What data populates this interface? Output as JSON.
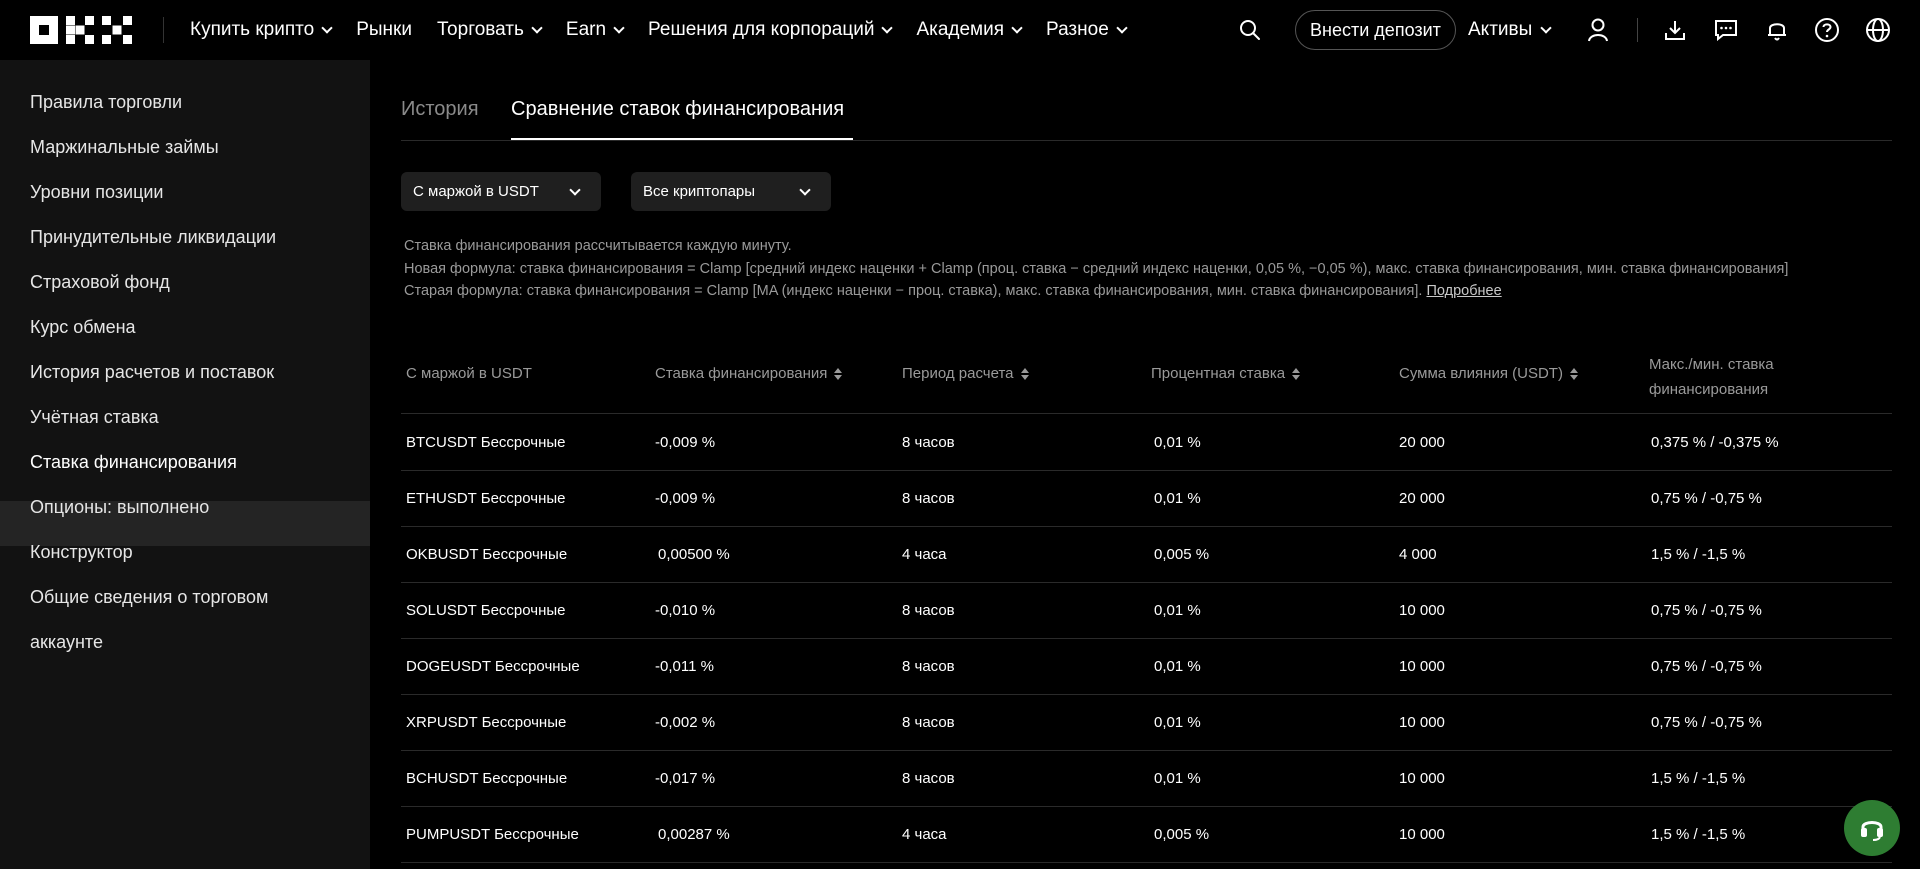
{
  "nav": {
    "items": [
      {
        "label": "Купить крипто",
        "dropdown": true
      },
      {
        "label": "Рынки",
        "dropdown": false
      },
      {
        "label": "Торговать",
        "dropdown": true
      },
      {
        "label": "Earn",
        "dropdown": true
      },
      {
        "label": "Решения для корпораций",
        "dropdown": true
      },
      {
        "label": "Академия",
        "dropdown": true
      },
      {
        "label": "Разное",
        "dropdown": true
      }
    ],
    "deposit_label": "Внести депозит",
    "assets_label": "Активы"
  },
  "sidebar": {
    "items": [
      {
        "label": "Правила торговли"
      },
      {
        "label": "Маржинальные займы"
      },
      {
        "label": "Уровни позиции"
      },
      {
        "label": "Принудительные ликвидации"
      },
      {
        "label": "Страховой фонд"
      },
      {
        "label": "Курс обмена"
      },
      {
        "label": "История расчетов и поставок"
      },
      {
        "label": "Учётная ставка"
      },
      {
        "label": "Ставка финансирования",
        "active": true
      },
      {
        "label": "Опционы: выполнено"
      },
      {
        "label": "Конструктор"
      },
      {
        "label": "Общие сведения о торговом"
      },
      {
        "label": "аккаунте"
      }
    ]
  },
  "tabs": {
    "history": "История",
    "compare": "Сравнение ставок финансирования"
  },
  "filters": {
    "margin": "С маржой в USDT",
    "pairs": "Все криптопары"
  },
  "notes": {
    "line1": "Ставка финансирования рассчитывается каждую минуту.",
    "line2": "Новая формула: ставка финансирования = Clamp [средний индекс наценки + Clamp (проц. ставка − средний индекс наценки, 0,05 %, −0,05 %), макс. ставка финансирования, мин. ставка финансирования]",
    "line3": "Старая формула: ставка финансирования = Clamp [MA (индекс наценки − проц. ставка), макс. ставка финансирования, мин. ставка финансирования].",
    "more_link": "Подробнее"
  },
  "table": {
    "headers": {
      "pair": "С маржой в USDT",
      "rate": "Ставка финансирования",
      "period": "Период расчета",
      "interest": "Процентная ставка",
      "impact": "Сумма влияния (USDT)",
      "maxmin_line1": "Макс./мин. ставка",
      "maxmin_line2": "финансирования"
    },
    "rows": [
      {
        "pair": "BTCUSDT Бессрочные",
        "rate": "-0,009 %",
        "period": "8 часов",
        "interest": "0,01 %",
        "impact": "20 000",
        "maxmin": "0,375 % / -0,375 %"
      },
      {
        "pair": "ETHUSDT Бессрочные",
        "rate": "-0,009 %",
        "period": "8 часов",
        "interest": "0,01 %",
        "impact": "20 000",
        "maxmin": "0,75 % / -0,75 %"
      },
      {
        "pair": "OKBUSDT Бессрочные",
        "rate": " 0,00500 %",
        "period": "4 часа",
        "interest": "0,005 %",
        "impact": "4 000",
        "maxmin": "1,5 % / -1,5 %"
      },
      {
        "pair": "SOLUSDT Бессрочные",
        "rate": "-0,010 %",
        "period": "8 часов",
        "interest": "0,01 %",
        "impact": "10 000",
        "maxmin": "0,75 % / -0,75 %"
      },
      {
        "pair": "DOGEUSDT Бессрочные",
        "rate": "-0,011 %",
        "period": "8 часов",
        "interest": "0,01 %",
        "impact": "10 000",
        "maxmin": "0,75 % / -0,75 %"
      },
      {
        "pair": "XRPUSDT Бессрочные",
        "rate": "-0,002 %",
        "period": "8 часов",
        "interest": "0,01 %",
        "impact": "10 000",
        "maxmin": "0,75 % / -0,75 %"
      },
      {
        "pair": "BCHUSDT Бессрочные",
        "rate": "-0,017 %",
        "period": "8 часов",
        "interest": "0,01 %",
        "impact": "10 000",
        "maxmin": "1,5 % / -1,5 %"
      },
      {
        "pair": "PUMPUSDT Бессрочные",
        "rate": " 0,00287 %",
        "period": "4 часа",
        "interest": "0,005 %",
        "impact": "10 000",
        "maxmin": "1,5 % / -1,5 %"
      }
    ]
  },
  "colors": {
    "background": "#000000",
    "sidebar": "#121212",
    "sidebar_active": "#242424",
    "support_button": "#2e7d32"
  },
  "icons": [
    "okx-logo",
    "search-icon",
    "user-icon",
    "download-icon",
    "chat-icon",
    "bell-icon",
    "help-icon",
    "globe-icon",
    "headset-icon"
  ]
}
